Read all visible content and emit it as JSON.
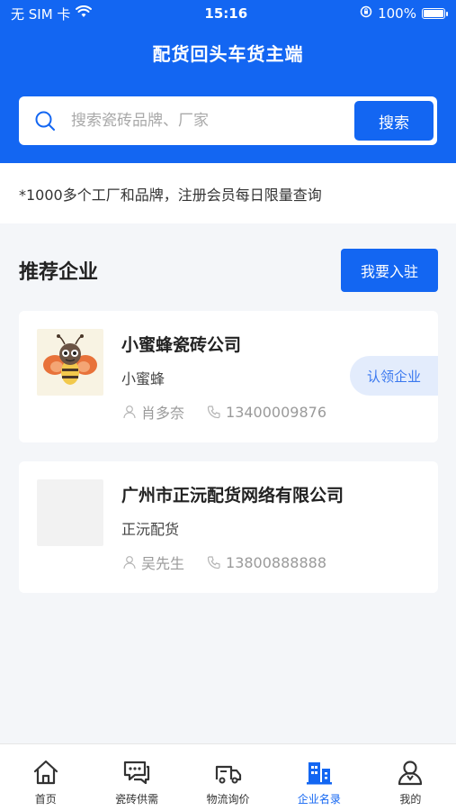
{
  "status_bar": {
    "carrier": "无 SIM 卡",
    "time": "15:16",
    "battery": "100%"
  },
  "header": {
    "title": "配货回头车货主端"
  },
  "search": {
    "placeholder": "搜索瓷砖品牌、厂家",
    "button_label": "搜索"
  },
  "notice": "*1000多个工厂和品牌，注册会员每日限量查询",
  "section": {
    "title": "推荐企业",
    "join_button": "我要入驻"
  },
  "companies": [
    {
      "name": "小蜜蜂瓷砖公司",
      "short_name": "小蜜蜂",
      "contact": "肖多奈",
      "phone": "13400009876",
      "badge": "认领企业",
      "logo_icon": "bee-logo"
    },
    {
      "name": "广州市正沅配货网络有限公司",
      "short_name": "正沅配货",
      "contact": "吴先生",
      "phone": "13800888888",
      "logo_icon": "placeholder-logo"
    }
  ],
  "tabbar": {
    "items": [
      {
        "label": "首页",
        "icon": "home-icon",
        "active": false
      },
      {
        "label": "瓷砖供需",
        "icon": "chat-icon",
        "active": false
      },
      {
        "label": "物流询价",
        "icon": "truck-icon",
        "active": false
      },
      {
        "label": "企业名录",
        "icon": "buildings-icon",
        "active": true
      },
      {
        "label": "我的",
        "icon": "user-icon",
        "active": false
      }
    ]
  },
  "colors": {
    "primary": "#1366f2",
    "badge_bg": "#e3ecfc",
    "background": "#f4f6f9"
  }
}
